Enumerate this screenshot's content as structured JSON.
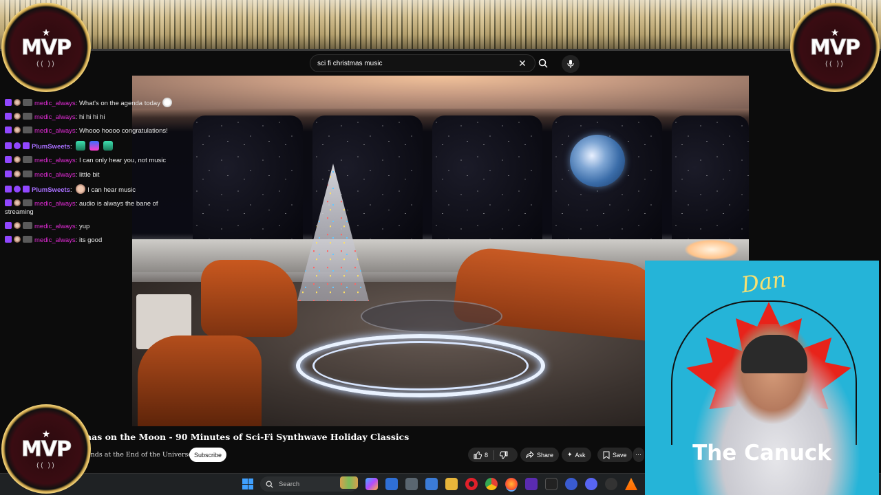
{
  "search": {
    "query": "sci fi christmas music",
    "placeholder": "Search"
  },
  "chat": {
    "messages": [
      {
        "user": "medic_always",
        "text": "What's on the agenda today",
        "style": "pink",
        "emote": "face"
      },
      {
        "user": "medic_always",
        "text": "hi hi hi hi",
        "style": "pink"
      },
      {
        "user": "medic_always",
        "text": "Whooo hoooo congratulations!",
        "style": "pink"
      },
      {
        "user": "PlumSweets",
        "text": "",
        "style": "purple",
        "emotes": [
          "green",
          "blue",
          "green"
        ]
      },
      {
        "user": "medic_always",
        "text": "I can only hear you, not music",
        "style": "pink"
      },
      {
        "user": "medic_always",
        "text": "little bit",
        "style": "pink"
      },
      {
        "user": "PlumSweets",
        "text": "I can hear music",
        "style": "purple",
        "emote": "cat"
      },
      {
        "user": "medic_always",
        "text": "audio is always the bane of streaming",
        "style": "pink"
      },
      {
        "user": "medic_always",
        "text": "yup",
        "style": "pink"
      },
      {
        "user": "medic_always",
        "text": "its good",
        "style": "pink"
      }
    ]
  },
  "video": {
    "title": "nas on the Moon - 90 Minutes of Sci-Fi Synthwave Holiday Classics",
    "channel": "ands at the End of the Universe",
    "subscribe_label": "Subscribe",
    "like_count": "8",
    "share_label": "Share",
    "ask_label": "Ask",
    "save_label": "Save",
    "more_label": "⋯"
  },
  "taskbar": {
    "search_label": "Search"
  },
  "overlay": {
    "logo_text": "MVP",
    "cam_signature": "Dan",
    "cam_name": "The Canuck"
  },
  "colors": {
    "chat_user_pink": "#e02bd4",
    "chat_user_purple": "#a970ff",
    "cam_bg": "#25b4d8",
    "maple_red": "#e8231a"
  }
}
